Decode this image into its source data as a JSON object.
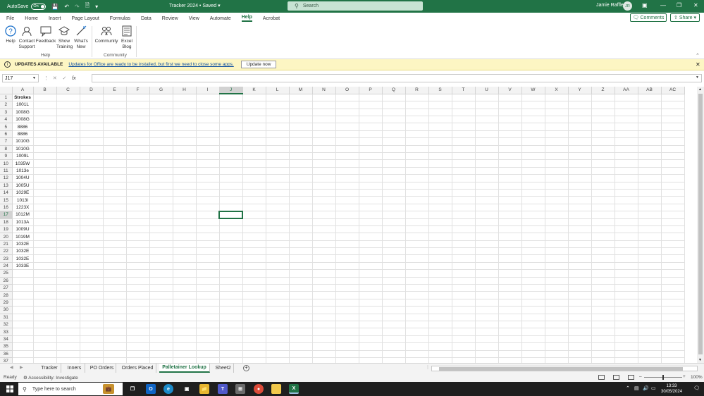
{
  "window": {
    "autosave_label": "AutoSave",
    "autosave_state": "On",
    "title": "Tracker 2024",
    "save_status": "Saved",
    "search_placeholder": "Search",
    "user_name": "Jamie Raffle",
    "user_initials": "JR"
  },
  "menu": {
    "tabs": [
      "File",
      "Home",
      "Insert",
      "Page Layout",
      "Formulas",
      "Data",
      "Review",
      "View",
      "Automate",
      "Help",
      "Acrobat"
    ],
    "active_tab": "Help",
    "comments_label": "Comments",
    "share_label": "Share"
  },
  "ribbon": {
    "buttons": [
      {
        "label": "Help",
        "icon": "help-icon"
      },
      {
        "label": "Contact Support",
        "icon": "contact-support-icon"
      },
      {
        "label": "Feedback",
        "icon": "feedback-icon"
      },
      {
        "label": "Show Training",
        "icon": "training-icon"
      },
      {
        "label": "What's New",
        "icon": "whats-new-icon"
      },
      {
        "label": "Community",
        "icon": "community-icon"
      },
      {
        "label": "Excel Blog",
        "icon": "blog-icon"
      }
    ],
    "groups": [
      "Help",
      "Community"
    ]
  },
  "infobar": {
    "title": "UPDATES AVAILABLE",
    "message": "Updates for Office are ready to be installed, but first we need to close some apps.",
    "button": "Update now"
  },
  "formula_bar": {
    "name_box": "J17",
    "fx": "fx",
    "value": ""
  },
  "grid": {
    "columns": [
      "A",
      "B",
      "C",
      "D",
      "E",
      "F",
      "G",
      "H",
      "I",
      "J",
      "K",
      "L",
      "M",
      "N",
      "O",
      "P",
      "Q",
      "R",
      "S",
      "T",
      "U",
      "V",
      "W",
      "X",
      "Y",
      "Z",
      "AA",
      "AB",
      "AC"
    ],
    "active_column": "J",
    "active_row": 17,
    "row_count": 37,
    "column_a": [
      "Strokes",
      "1001L",
      "1008G",
      "1008G",
      "8886",
      "8886",
      "1010G",
      "1010G",
      "1009L",
      "1035W",
      "1013e",
      "1004U",
      "1005U",
      "1029E",
      "1013I",
      "1223X",
      "1012M",
      "1013A",
      "1009U",
      "1019M",
      "1032E",
      "1032E",
      "1032E",
      "1033E"
    ]
  },
  "sheets": {
    "tabs": [
      "Tracker",
      "Inners",
      "PO Orders",
      "Orders Placed",
      "Palletainer Lookup",
      "Sheet2"
    ],
    "active": "Palletainer Lookup"
  },
  "status": {
    "ready": "Ready",
    "accessibility": "Accessibility: Investigate",
    "zoom": "100%"
  },
  "taskbar": {
    "search_placeholder": "Type here to search",
    "time": "13:33",
    "date": "30/05/2024"
  }
}
